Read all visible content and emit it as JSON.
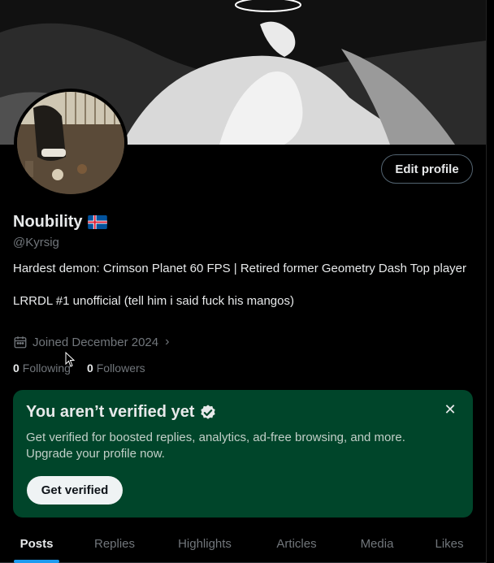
{
  "profile": {
    "name": "Noubility",
    "handle": "@Kyrsig",
    "flag": "iceland-flag",
    "bio_line1": "Hardest demon: Crimson Planet 60 FPS | Retired former Geometry Dash Top player",
    "bio_line2": "LRRDL #1 unofficial (tell him i said fuck his mangos)",
    "joined": "Joined December 2024",
    "following_count": "0",
    "following_label": "Following",
    "followers_count": "0",
    "followers_label": "Followers"
  },
  "actions": {
    "edit_profile": "Edit profile"
  },
  "verify_card": {
    "title": "You aren’t verified yet",
    "description": "Get verified for boosted replies, analytics, ad-free browsing, and more. Upgrade your profile now.",
    "button": "Get verified",
    "bg_color": "#00452a"
  },
  "tabs": [
    {
      "label": "Posts",
      "active": true
    },
    {
      "label": "Replies",
      "active": false
    },
    {
      "label": "Highlights",
      "active": false
    },
    {
      "label": "Articles",
      "active": false
    },
    {
      "label": "Media",
      "active": false
    },
    {
      "label": "Likes",
      "active": false
    }
  ],
  "colors": {
    "accent": "#1d9bf0",
    "muted": "#71767b",
    "text": "#e7e9ea"
  }
}
